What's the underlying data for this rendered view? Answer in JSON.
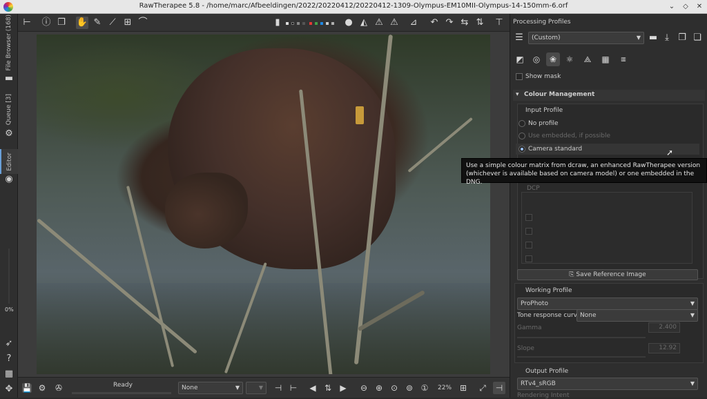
{
  "window": {
    "title": "RawTherapee 5.8 - /home/marc/Afbeeldingen/2022/20220412/20220412-1309-Olympus-EM10MII-Olympus-14-150mm-6.orf"
  },
  "left_tabs": {
    "file_browser": "File Browser (168)",
    "queue": "Queue [3]",
    "editor": "Editor",
    "progress": "0%"
  },
  "status": {
    "ready": "Ready",
    "preview_select": "None",
    "zoom": "22%"
  },
  "profiles": {
    "header": "Processing Profiles",
    "selected": "(Custom)"
  },
  "tool_panel": {
    "show_mask": "Show mask",
    "section_title": "Colour Management",
    "input_profile": {
      "label": "Input Profile",
      "options": [
        "No profile",
        "Use embedded, if possible",
        "Camera standard"
      ],
      "selected": "Camera standard"
    },
    "dcp_label": "DCP",
    "save_reference": "Save Reference Image",
    "working_profile": {
      "label": "Working Profile",
      "value": "ProPhoto",
      "tone_response_label": "Tone response curve:",
      "tone_response_value": "None",
      "gamma_label": "Gamma",
      "gamma_value": "2.400",
      "slope_label": "Slope",
      "slope_value": "12.92"
    },
    "output_profile": {
      "label": "Output Profile",
      "value": "RTv4_sRGB",
      "rendering_intent": "Rendering Intent"
    }
  },
  "tooltip": "Use a simple colour matrix from dcraw, an enhanced RawTherapee version (whichever is available based on camera model) or one embedded in the DNG.",
  "colors": {
    "accent": "#6aa0d8",
    "background": "#2a2a2a",
    "panel": "#2e2e2e"
  }
}
